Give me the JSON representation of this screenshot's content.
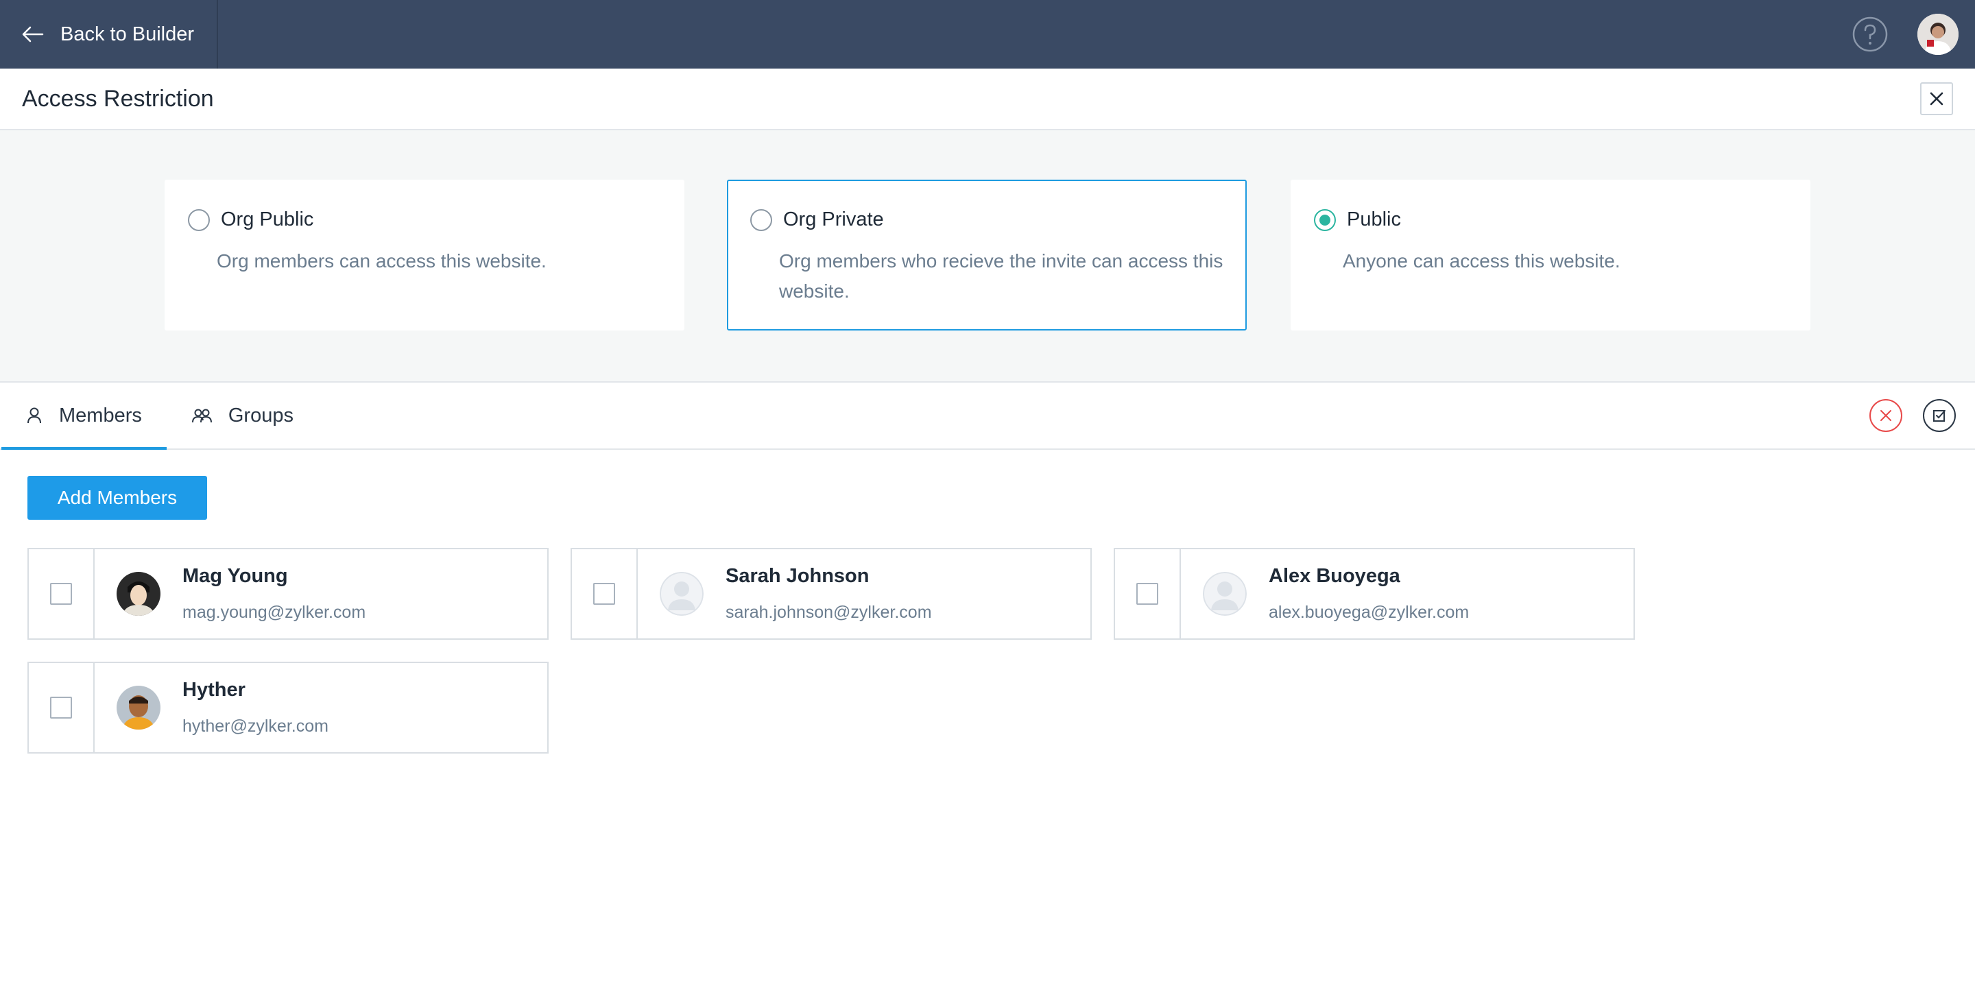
{
  "topbar": {
    "back_label": "Back to Builder",
    "icons": [
      "arrow-left-icon",
      "help-icon",
      "user-avatar"
    ]
  },
  "header": {
    "title": "Access Restriction",
    "close_icon": "close-icon"
  },
  "options": [
    {
      "label": "Org Public",
      "description": "Org members can access this website.",
      "selected": false
    },
    {
      "label": "Org Private",
      "description": "Org members who recieve the invite can access this website.",
      "selected": false
    },
    {
      "label": "Public",
      "description": "Anyone can access this website.",
      "selected": true
    }
  ],
  "tabs": [
    {
      "label": "Members",
      "icon": "person-icon",
      "active": true
    },
    {
      "label": "Groups",
      "icon": "group-icon",
      "active": false
    }
  ],
  "tab_actions": [
    "cancel-circle-icon",
    "save-check-icon"
  ],
  "add_members_label": "Add Members",
  "members": [
    {
      "name": "Mag Young",
      "email": "mag.young@zylker.com",
      "avatar": "photo"
    },
    {
      "name": "Sarah Johnson",
      "email": "sarah.johnson@zylker.com",
      "avatar": "placeholder"
    },
    {
      "name": "Alex Buoyega",
      "email": "alex.buoyega@zylker.com",
      "avatar": "placeholder"
    },
    {
      "name": "Hyther",
      "email": "hyther@zylker.com",
      "avatar": "photo"
    }
  ],
  "colors": {
    "topbar": "#3a4a64",
    "accent": "#1e9be0",
    "radio_selected": "#2bb5a0",
    "cancel": "#e84a4a"
  }
}
